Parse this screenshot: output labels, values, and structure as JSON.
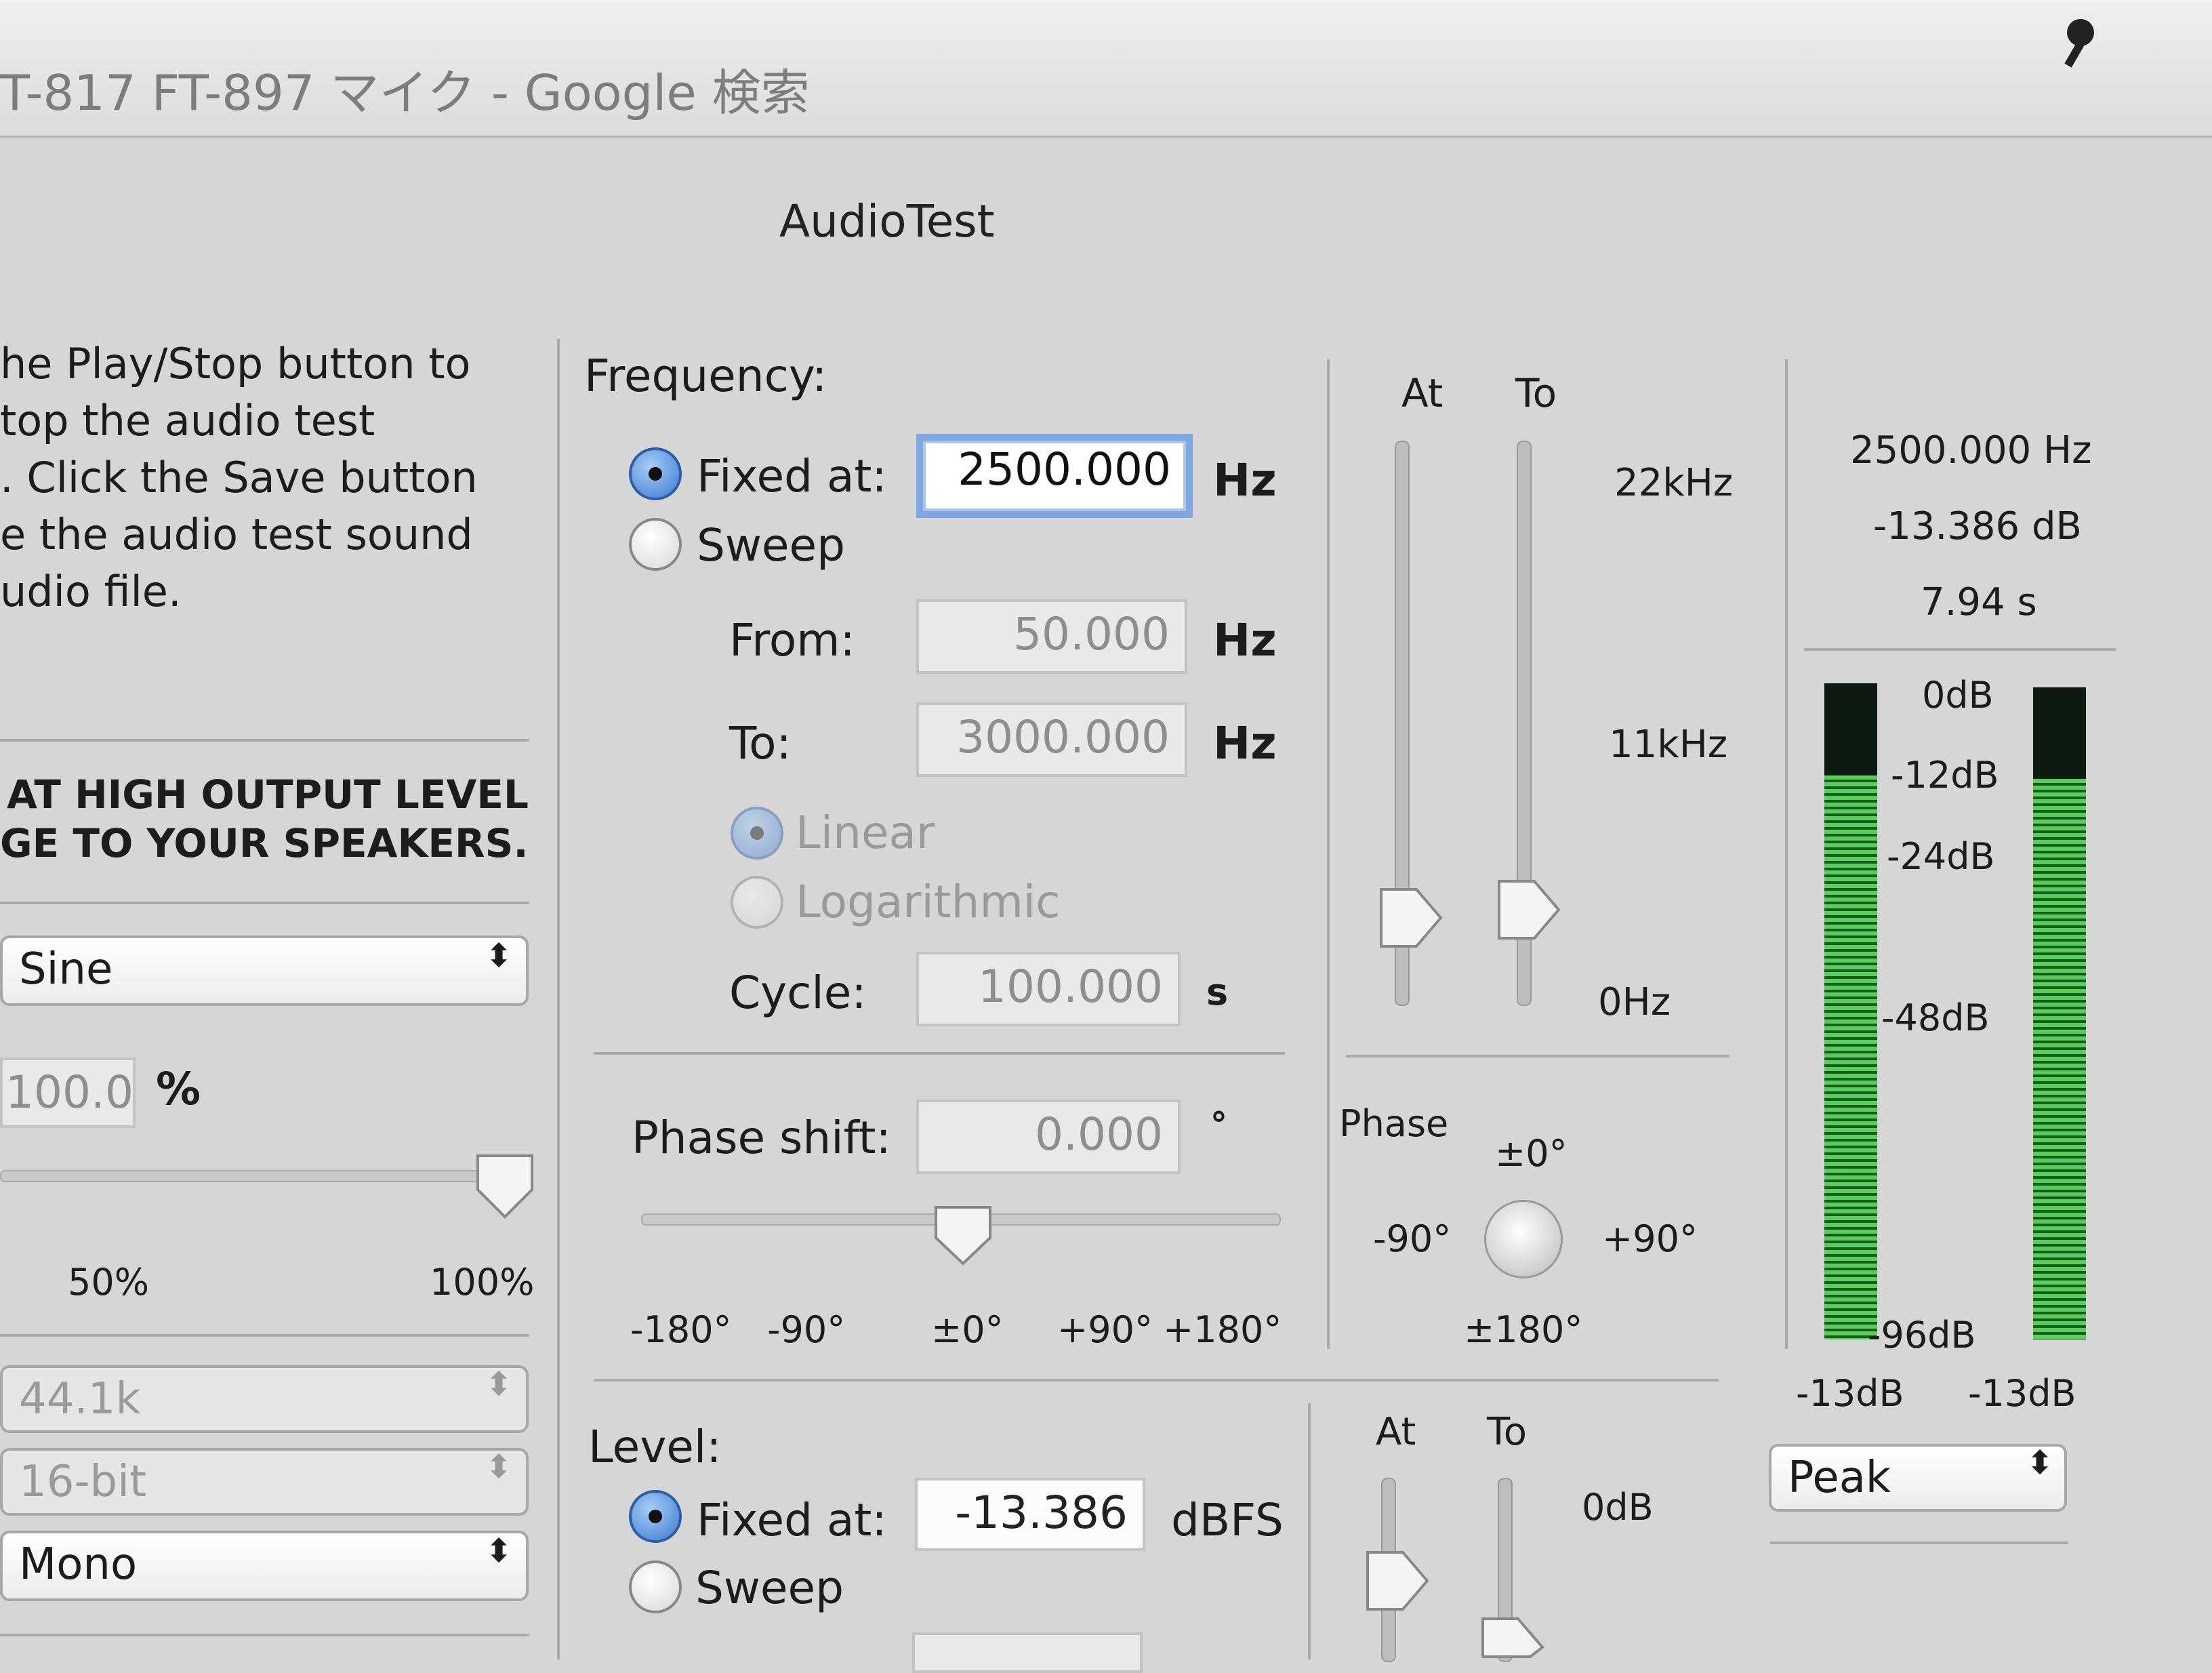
{
  "browser": {
    "title": "T-817 FT-897 マイク - Google 検索"
  },
  "window": {
    "title": "AudioTest"
  },
  "instructions": {
    "lines": [
      "he Play/Stop button to",
      "top the audio test",
      ". Click the Save button",
      "e the audio test sound",
      "udio file."
    ]
  },
  "warning": {
    "lines": [
      "AT HIGH OUTPUT LEVEL",
      "GE TO YOUR SPEAKERS."
    ]
  },
  "waveform": {
    "value": "Sine"
  },
  "amplitude": {
    "value": "100.0",
    "unit": "%",
    "fraction": 1.0,
    "scale_low": "50%",
    "scale_high": "100%"
  },
  "samplerate": {
    "value": "44.1k"
  },
  "bitdepth": {
    "value": "16-bit"
  },
  "channels": {
    "value": "Mono"
  },
  "frequency": {
    "section_label": "Frequency:",
    "fixed_label": "Fixed at:",
    "fixed_value": "2500.000",
    "unit": "Hz",
    "sweep_label": "Sweep",
    "from_label": "From:",
    "from_value": "50.000",
    "to_label": "To:",
    "to_value": "3000.000",
    "linear_label": "Linear",
    "log_label": "Logarithmic",
    "cycle_label": "Cycle:",
    "cycle_value": "100.000",
    "cycle_unit": "s"
  },
  "freq_sliders": {
    "at_label": "At",
    "to_label": "To",
    "top": "22kHz",
    "mid": "11kHz",
    "bottom": "0Hz"
  },
  "phase": {
    "label": "Phase shift:",
    "value": "0.000",
    "unit": "°",
    "ticks": [
      "-180°",
      "-90°",
      "±0°",
      "+90°",
      "+180°"
    ],
    "knob_label": "Phase",
    "knob_top": "±0°",
    "knob_left": "-90°",
    "knob_right": "+90°",
    "knob_bottom": "±180°"
  },
  "level": {
    "section_label": "Level:",
    "fixed_label": "Fixed at:",
    "fixed_value": "-13.386",
    "unit": "dBFS",
    "sweep_label": "Sweep"
  },
  "level_sliders": {
    "at_label": "At",
    "to_label": "To",
    "top": "0dB"
  },
  "readout": {
    "freq": "2500.000 Hz",
    "db": "-13.386 dB",
    "time": "7.94 s"
  },
  "meter": {
    "scale": [
      "0dB",
      "-12dB",
      "-24dB",
      "-48dB",
      "-96dB"
    ],
    "left_label": "-13dB",
    "right_label": "-13dB",
    "left_level": 0.86,
    "right_level": 0.86,
    "mode": "Peak"
  },
  "colors": {
    "meter_green": "#55d05a",
    "focus_ring": "#7fa7df",
    "radio_on": "#3b7ad2"
  }
}
